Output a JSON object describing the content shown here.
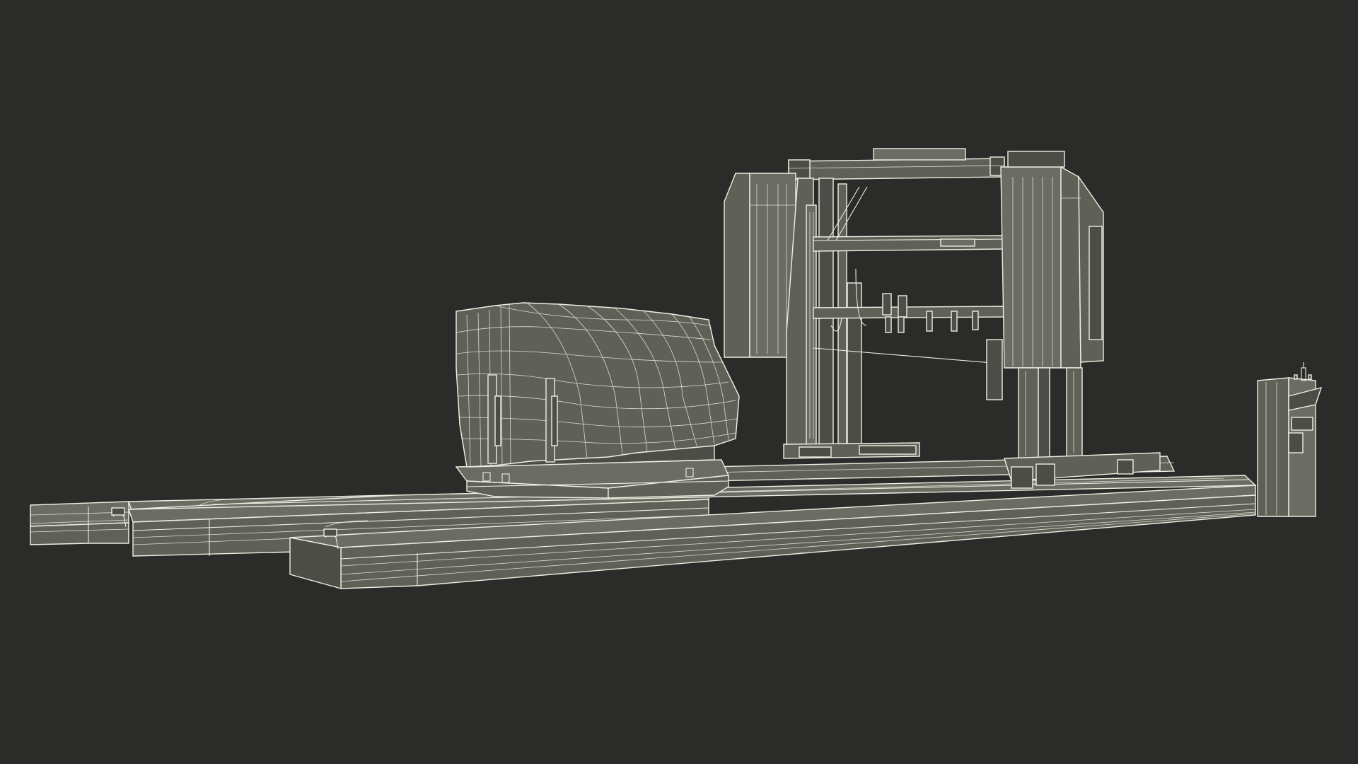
{
  "scene": {
    "subject": "wireframe-render",
    "colors": {
      "background": "#2b2b2a",
      "wire": "#eef0e2",
      "surface": "#5f6058"
    }
  }
}
